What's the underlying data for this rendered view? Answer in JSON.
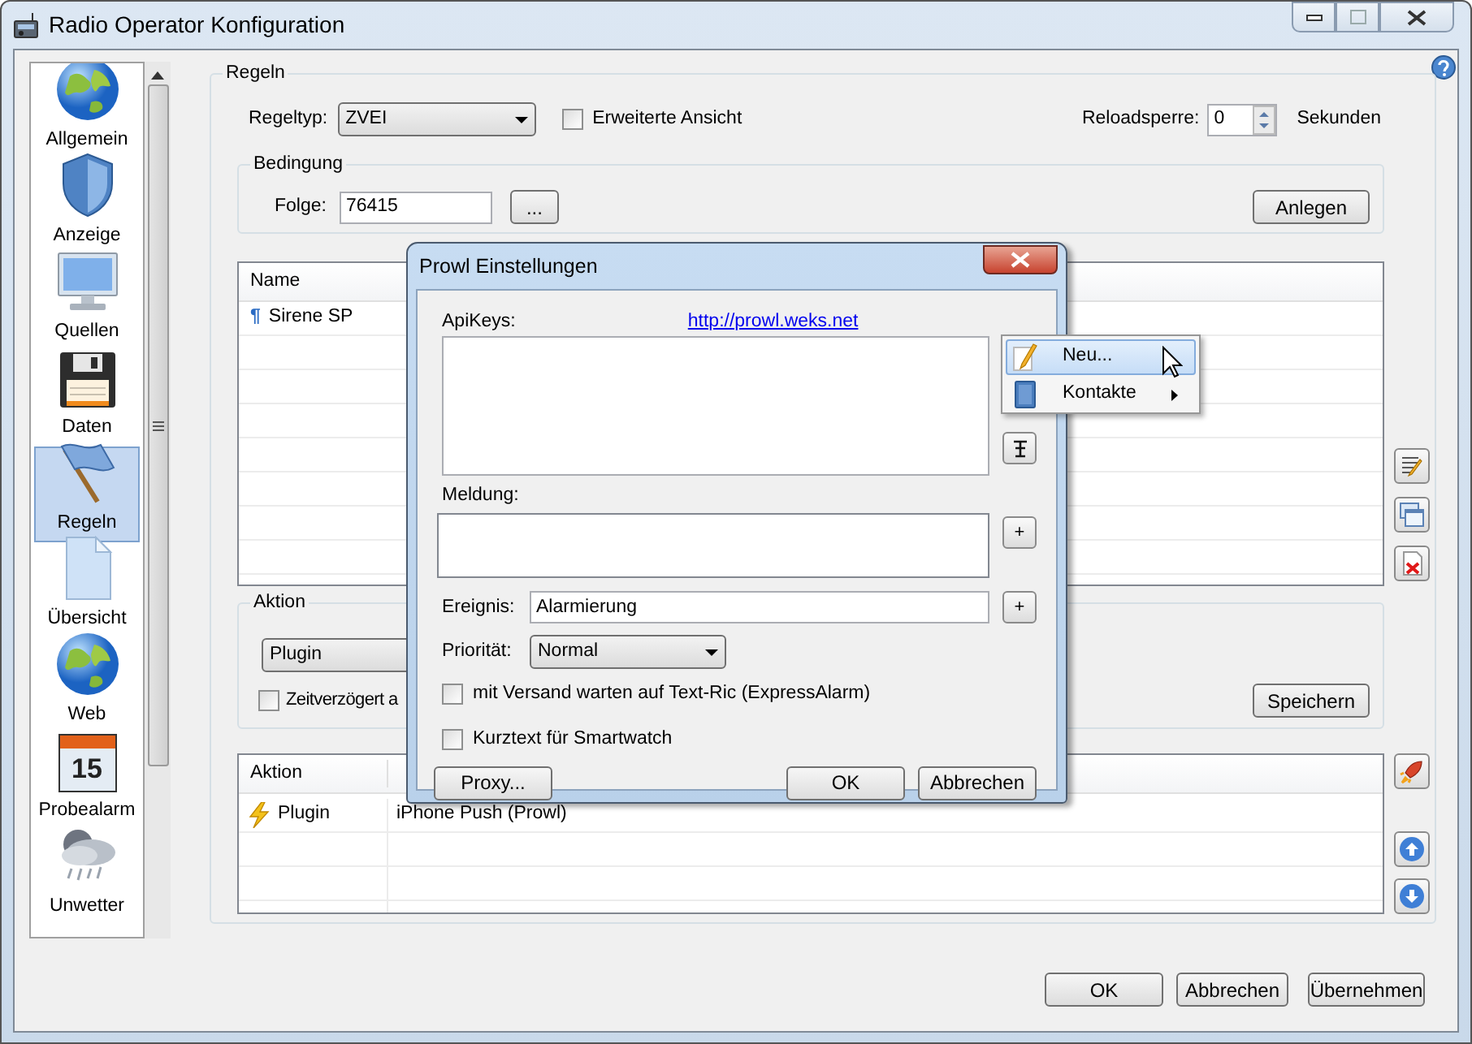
{
  "window": {
    "title": "Radio Operator Konfiguration"
  },
  "sidebar": {
    "items": [
      {
        "label": "Allgemein",
        "selected": false
      },
      {
        "label": "Anzeige",
        "selected": false
      },
      {
        "label": "Quellen",
        "selected": false
      },
      {
        "label": "Daten",
        "selected": false
      },
      {
        "label": "Regeln",
        "selected": true
      },
      {
        "label": "Übersicht",
        "selected": false
      },
      {
        "label": "Web",
        "selected": false
      },
      {
        "label": "Probealarm",
        "icon_text": "15",
        "selected": false
      },
      {
        "label": "Unwetter",
        "selected": false
      }
    ]
  },
  "rules": {
    "title": "Regeln",
    "rule_type": {
      "label": "Regeltyp:",
      "value": "ZVEI"
    },
    "extended_view": {
      "label": "Erweiterte Ansicht",
      "checked": false
    },
    "reload": {
      "label": "Reloadsperre:",
      "value": "0",
      "unit": "Sekunden"
    },
    "condition": {
      "title": "Bedingung",
      "label": "Folge:",
      "value": "76415",
      "browse": "...",
      "button": "Anlegen"
    },
    "rules_table": {
      "columns": [
        "Name"
      ],
      "rows": [
        {
          "marker": "¶",
          "name": "Sirene SP"
        }
      ]
    },
    "action": {
      "title": "Aktion",
      "type": "Plugin",
      "delayed": {
        "label": "Zeitverzögert a",
        "checked": false
      },
      "button": "Speichern"
    },
    "actions_table": {
      "columns": [
        "Aktion"
      ],
      "rows": [
        {
          "cells": [
            "Plugin",
            "iPhone Push (Prowl)"
          ]
        }
      ]
    }
  },
  "buttons": [
    "OK",
    "Abbrechen",
    "Übernehmen"
  ],
  "dialog": {
    "title": "Prowl Einstellungen",
    "api_keys": {
      "label": "ApiKeys:",
      "link": "http://prowl.weks.net"
    },
    "message": {
      "label": "Meldung:",
      "add": "+"
    },
    "event": {
      "label": "Ereignis:",
      "value": "Alarmierung",
      "add": "+"
    },
    "priority": {
      "label": "Priorität:",
      "value": "Normal"
    },
    "options": [
      {
        "label": "mit Versand warten auf Text-Ric (ExpressAlarm)",
        "checked": false
      },
      {
        "label": "Kurztext für Smartwatch",
        "checked": false
      }
    ],
    "proxy": "Proxy...",
    "buttons": [
      "OK",
      "Abbrechen"
    ]
  },
  "context_menu": {
    "items": [
      {
        "label": "Neu...",
        "selected": true,
        "submenu": false
      },
      {
        "label": "Kontakte",
        "selected": false,
        "submenu": true
      }
    ]
  }
}
